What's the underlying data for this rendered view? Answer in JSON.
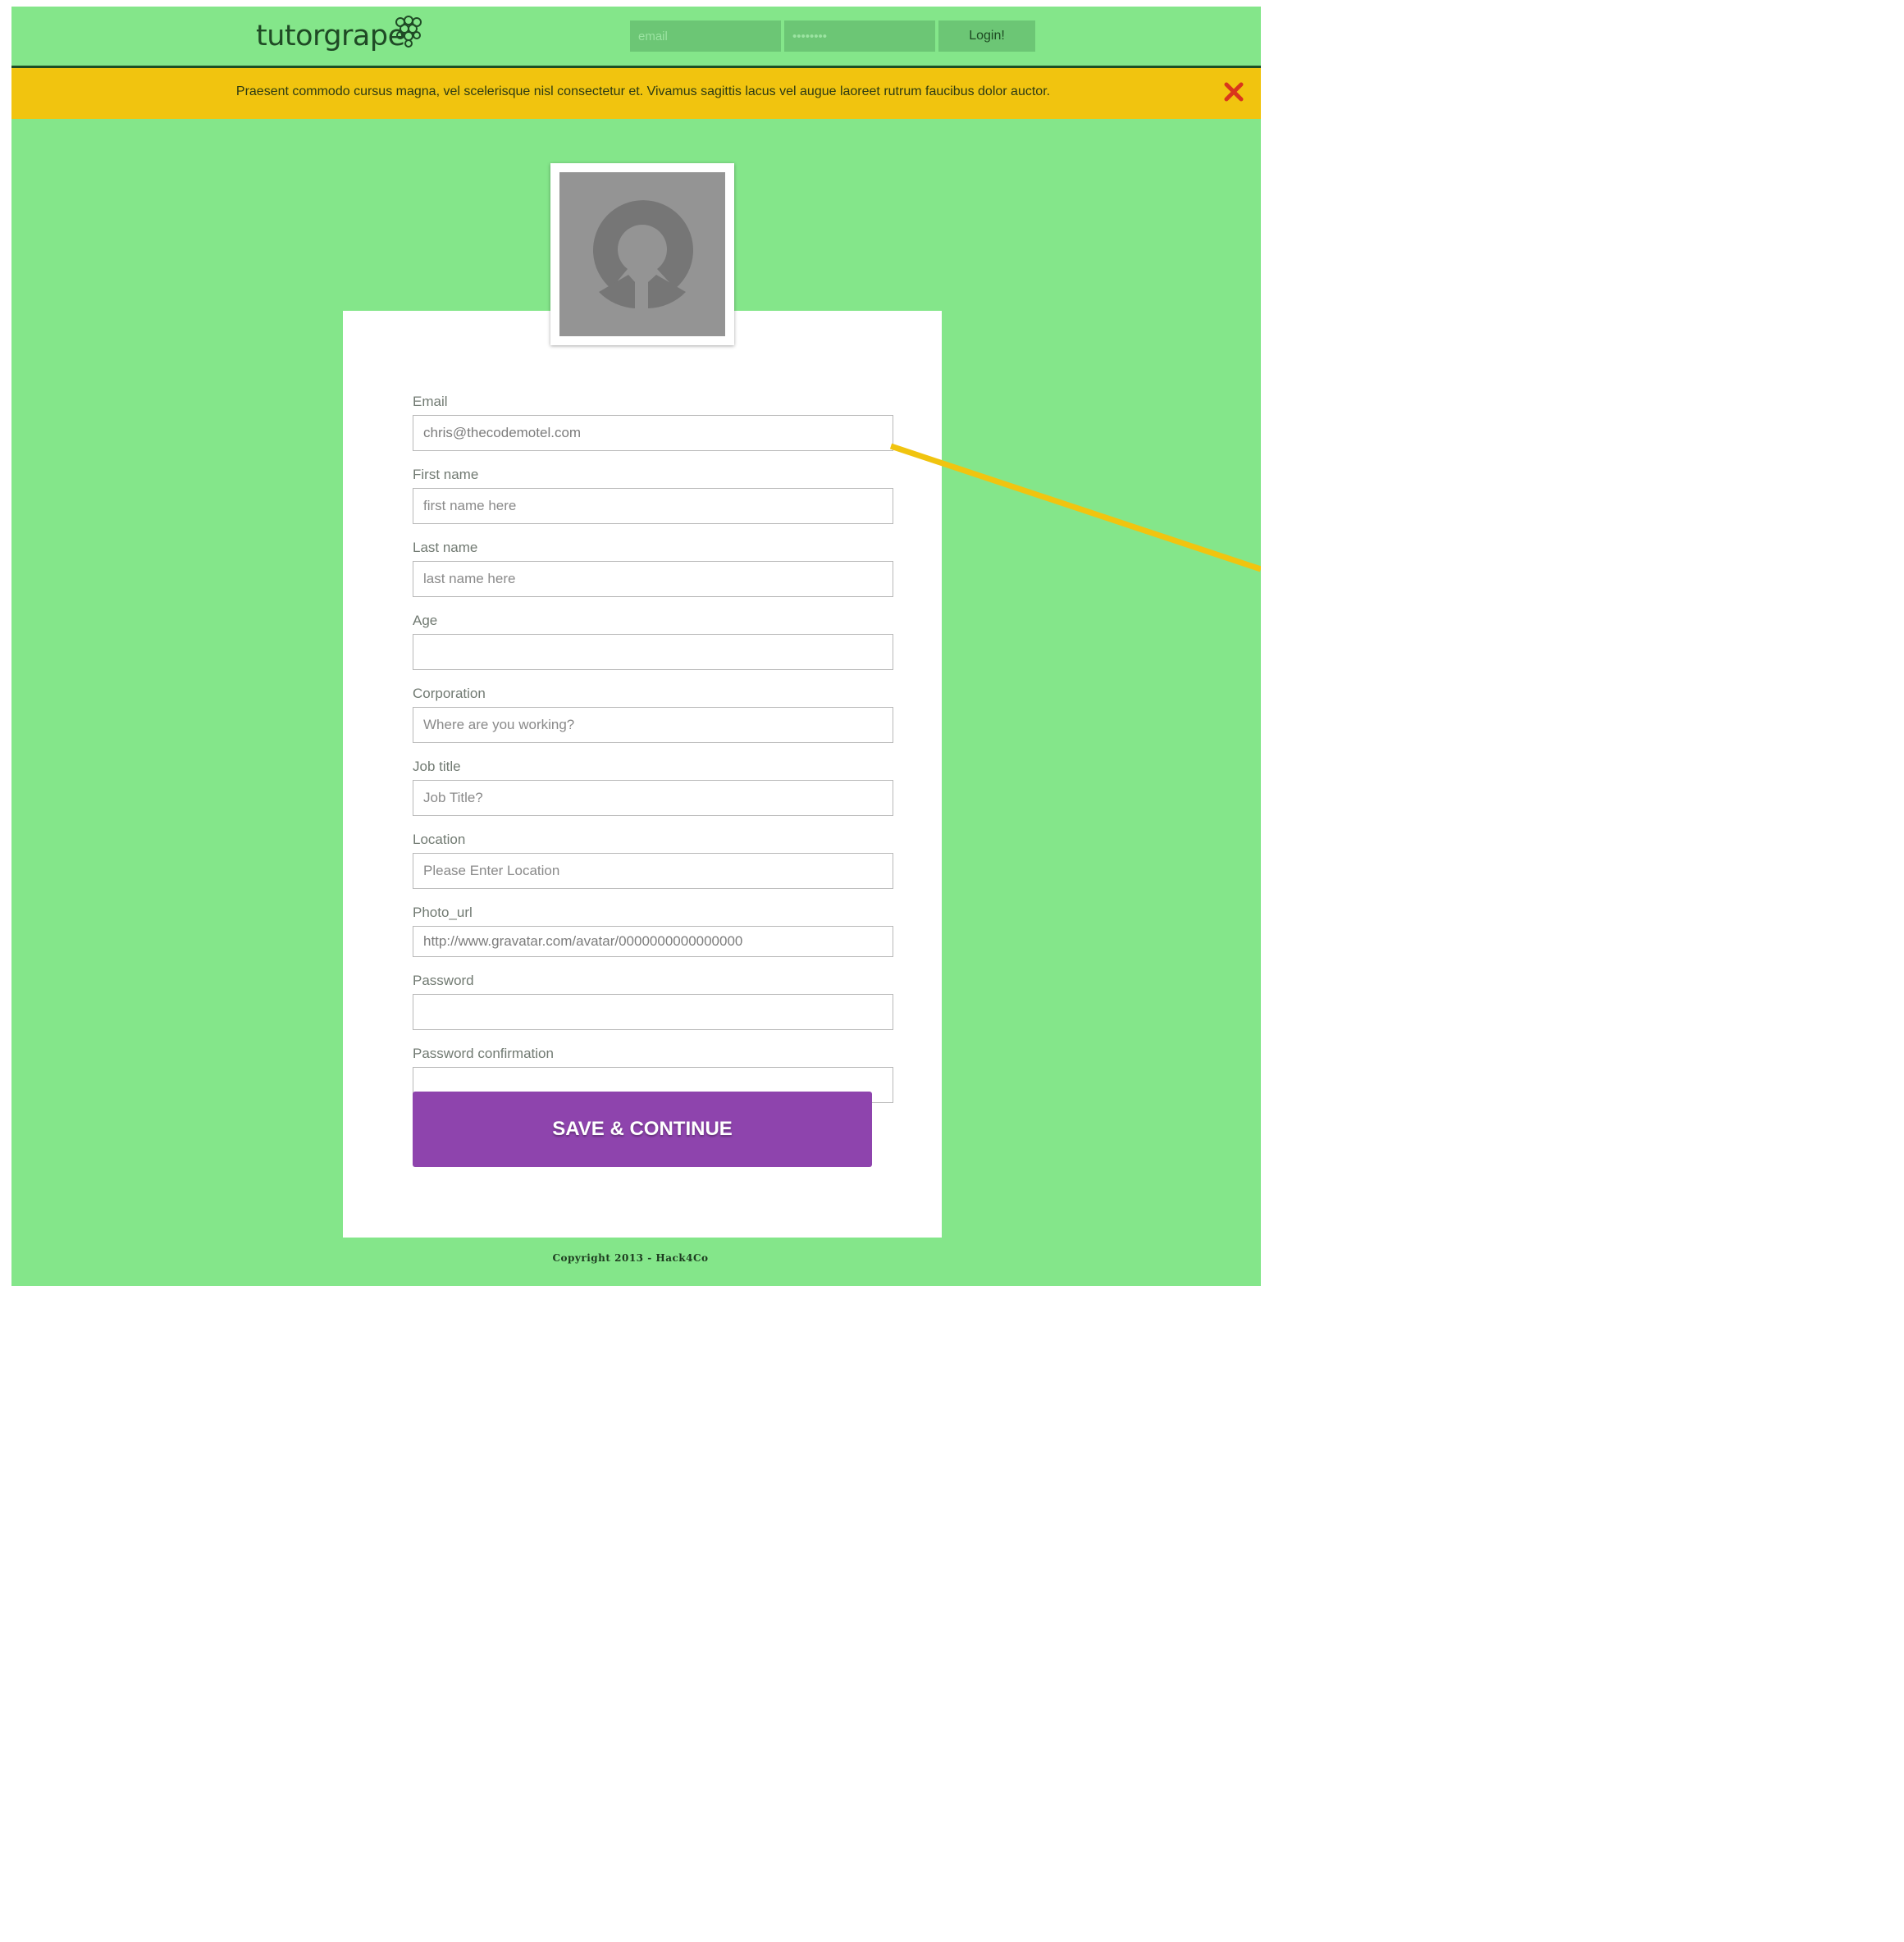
{
  "header": {
    "logo_text": "tutorgrape",
    "login": {
      "email_placeholder": "email",
      "password_placeholder": "••••••••",
      "button_label": "Login!"
    }
  },
  "alert": {
    "message": "Praesent commodo cursus magna, vel scelerisque nisl consectetur et. Vivamus sagittis lacus vel augue laoreet rutrum faucibus dolor auctor.",
    "close_icon": "close-icon",
    "close_color": "#d9361c"
  },
  "form": {
    "fields": [
      {
        "label": "Email",
        "value": "chris@thecodemotel.com",
        "placeholder": ""
      },
      {
        "label": "First name",
        "value": "",
        "placeholder": "first name here"
      },
      {
        "label": "Last name",
        "value": "",
        "placeholder": "last name here"
      },
      {
        "label": "Age",
        "value": "",
        "placeholder": ""
      },
      {
        "label": "Corporation",
        "value": "",
        "placeholder": "Where are you working?"
      },
      {
        "label": "Job title",
        "value": "",
        "placeholder": "Job Title?"
      },
      {
        "label": "Location",
        "value": "",
        "placeholder": "Please Enter Location"
      },
      {
        "label": "Photo_url",
        "value": "http://www.gravatar.com/avatar/0000000000000000",
        "placeholder": ""
      },
      {
        "label": "Password",
        "value": "",
        "placeholder": ""
      },
      {
        "label": "Password confirmation",
        "value": "",
        "placeholder": ""
      }
    ],
    "submit_label": "SAVE & CONTINUE"
  },
  "footer": {
    "copyright": "Copyright 2013 - Hack4Co"
  },
  "colors": {
    "background": "#84e68a",
    "alert": "#f1c40f",
    "accent": "#8e44ad",
    "login_field": "#6cc675"
  },
  "icons": {
    "logo": "grape-icon",
    "avatar": "default-avatar-icon"
  }
}
